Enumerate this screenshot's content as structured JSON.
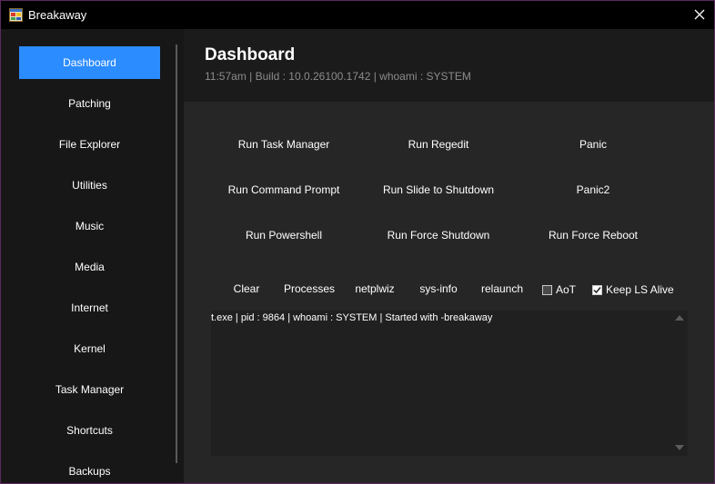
{
  "window": {
    "title": "Breakaway"
  },
  "sidebar": {
    "items": [
      {
        "label": "Dashboard",
        "active": true
      },
      {
        "label": "Patching"
      },
      {
        "label": "File Explorer"
      },
      {
        "label": "Utilities"
      },
      {
        "label": "Music"
      },
      {
        "label": "Media"
      },
      {
        "label": "Internet"
      },
      {
        "label": "Kernel"
      },
      {
        "label": "Task Manager"
      },
      {
        "label": "Shortcuts"
      },
      {
        "label": "Backups"
      }
    ]
  },
  "header": {
    "title": "Dashboard",
    "subtitle": "11:57am | Build : 10.0.26100.1742 | whoami : SYSTEM"
  },
  "actions": {
    "run_task_manager": "Run Task Manager",
    "run_regedit": "Run Regedit",
    "panic": "Panic",
    "run_command_prompt": "Run Command Prompt",
    "run_slide_to_shutdown": "Run Slide to Shutdown",
    "panic2": "Panic2",
    "run_powershell": "Run Powershell",
    "run_force_shutdown": "Run Force Shutdown",
    "run_force_reboot": "Run Force Reboot"
  },
  "toolbar": {
    "clear": "Clear",
    "processes": "Processes",
    "netplwiz": "netplwiz",
    "sys_info": "sys-info",
    "relaunch": "relaunch",
    "aot": {
      "label": "AoT",
      "checked": false
    },
    "keep_ls_alive": {
      "label": "Keep LS Alive",
      "checked": true
    }
  },
  "log": {
    "text": "t.exe | pid : 9864 | whoami : SYSTEM | Started with -breakaway"
  },
  "colors": {
    "accent": "#2b8cff",
    "window_border": "#5c2a5c"
  }
}
